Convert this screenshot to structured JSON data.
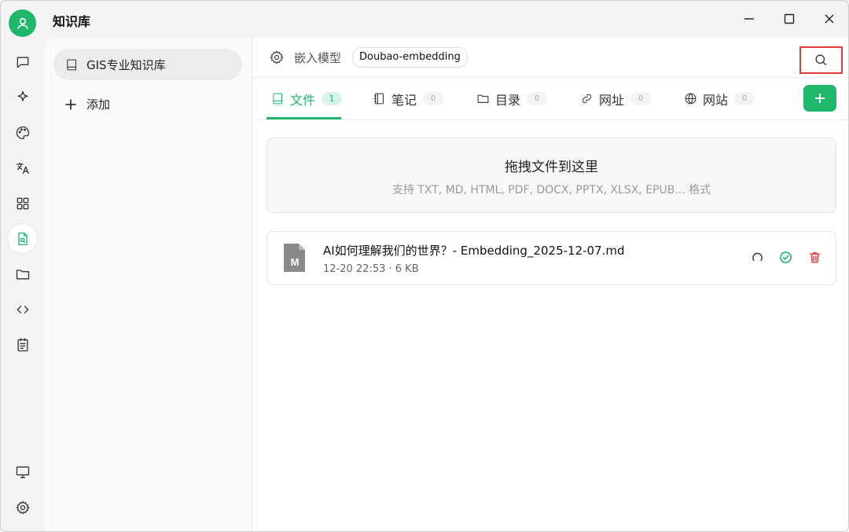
{
  "window": {
    "title": "知识库"
  },
  "rail": {
    "items": [
      "chat-icon",
      "sparkle-icon",
      "palette-icon",
      "translate-icon",
      "apps-icon",
      "knowledge-icon",
      "folder-icon",
      "code-icon",
      "notes-icon",
      "monitor-icon",
      "settings-icon"
    ],
    "active": "knowledge-icon"
  },
  "kb_list": {
    "items": [
      {
        "label": "GIS专业知识库"
      }
    ],
    "add_label": "添加"
  },
  "main": {
    "embed_label": "嵌入模型",
    "embed_model": "Doubao-embedding",
    "tabs": [
      {
        "label": "文件",
        "count": "1"
      },
      {
        "label": "笔记",
        "count": "0"
      },
      {
        "label": "目录",
        "count": "0"
      },
      {
        "label": "网址",
        "count": "0"
      },
      {
        "label": "网站",
        "count": "0"
      }
    ],
    "dropzone": {
      "title": "拖拽文件到这里",
      "subtitle": "支持 TXT, MD, HTML, PDF, DOCX, PPTX, XLSX, EPUB... 格式"
    },
    "files": [
      {
        "name": "AI如何理解我们的世界？- Embedding_2025-12-07.md",
        "meta": "12-20 22:53 · 6 KB",
        "badge": "M"
      }
    ]
  },
  "colors": {
    "accent": "#1fb86b",
    "highlight_border": "#e23b3b",
    "delete": "#e5484d"
  }
}
